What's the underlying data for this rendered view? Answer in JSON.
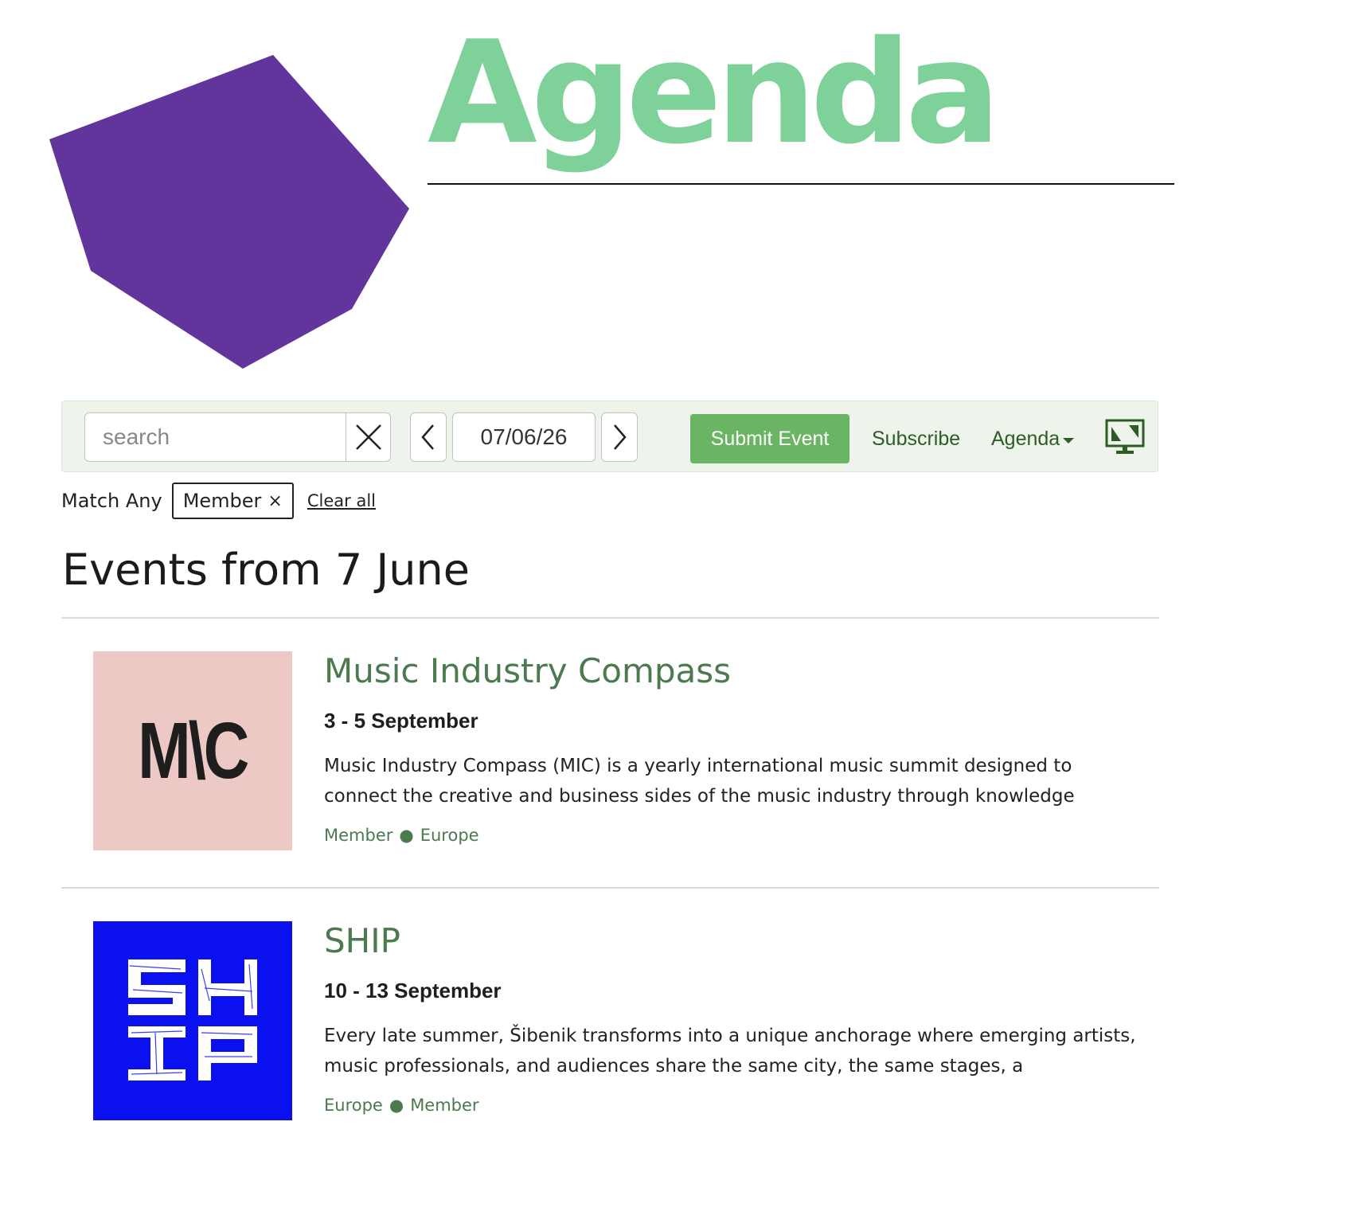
{
  "header": {
    "title": "Agenda"
  },
  "colors": {
    "hexagon": "#62359d",
    "title": "#7fd19a",
    "submit_button": "#6ab563",
    "link": "#2c5d26",
    "event_title": "#4b7a4e"
  },
  "toolbar": {
    "search": {
      "value": "",
      "placeholder": "search",
      "clear_icon": "close-icon"
    },
    "prev_icon": "chevron-left-icon",
    "date_value": "07/06/26",
    "next_icon": "chevron-right-icon",
    "submit_label": "Submit Event",
    "subscribe_label": "Subscribe",
    "view_label": "Agenda",
    "display_icon": "monitor-icon"
  },
  "filters": {
    "match_label": "Match Any",
    "active": [
      {
        "label": "Member",
        "remove": "×"
      }
    ],
    "clear_label": "Clear all"
  },
  "section": {
    "heading": "Events from 7 June"
  },
  "events": [
    {
      "title": "Music Industry Compass",
      "thumb_text": "M\\C",
      "thumb_bg": "#ecc9c5",
      "date": "3 - 5 September",
      "description": "Music Industry Compass (MIC) is a yearly international music summit designed to connect the creative and business sides of the music industry through knowledge",
      "tags": [
        "Member",
        "Europe"
      ],
      "tag_separator": "●"
    },
    {
      "title": "SHIP",
      "thumb_bg": "#0a10ee",
      "date": "10 - 13 September",
      "description": "Every late summer, Šibenik transforms into a unique anchorage where emerging artists, music professionals, and audiences share the same city, the same stages, a",
      "tags": [
        "Europe",
        "Member"
      ],
      "tag_separator": "●"
    }
  ]
}
